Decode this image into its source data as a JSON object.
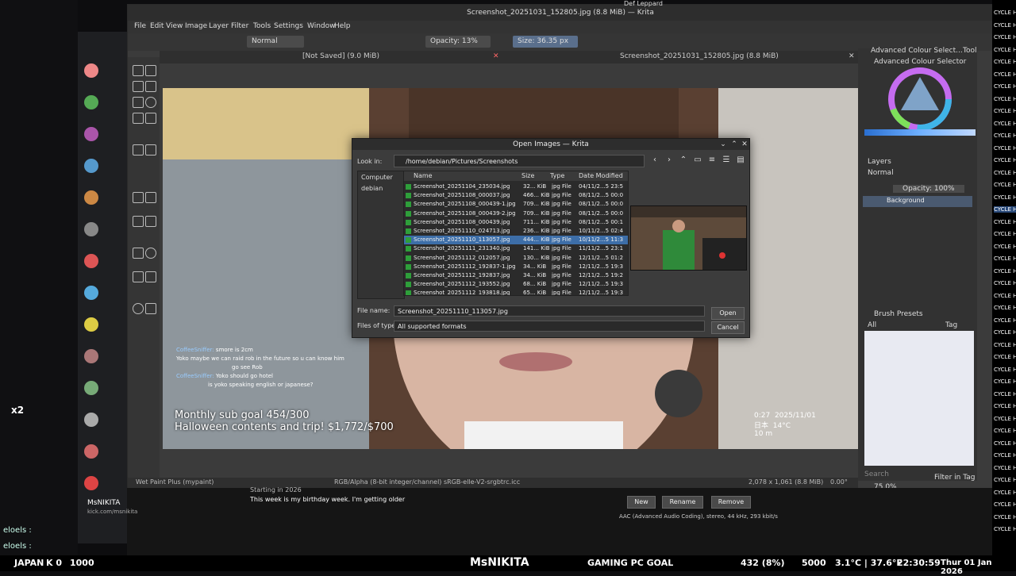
{
  "krita": {
    "title": "Screenshot_20251031_152805.jpg (8.8 MiB) — Krita",
    "menu": [
      "File",
      "Edit",
      "View",
      "Image",
      "Layer",
      "Filter",
      "Tools",
      "Settings",
      "Window",
      "Help"
    ],
    "blend_mode": "Normal",
    "opacity": "Opacity: 13%",
    "size": "Size: 36.35 px",
    "tab_unsaved": "[Not Saved]  (9.0 MiB)",
    "tab_doc": "Screenshot_20251031_152805.jpg (8.8 MiB)",
    "status_left": "Wet Paint Plus (mypaint)",
    "status_mid": "RGB/Alpha (8-bit integer/channel)  sRGB-elle-V2-srgbtrc.icc",
    "status_right": "2,078 x 1,061 (8.8 MiB)",
    "zoom": "75.0%",
    "rotation": "0.00°"
  },
  "dock": {
    "color_selector_tab": "Advanced Colour Select...",
    "tool_options_tab": "Tool Optio...",
    "color_selector_title": "Advanced Colour Selector",
    "layers_title": "Layers",
    "layers_mode": "Normal",
    "layers_opacity": "Opacity:  100%",
    "layer_name": "Background",
    "brush_title": "Brush Presets",
    "brush_filter": "All",
    "brush_tag": "Tag",
    "search": "Search",
    "filter_tag": "Filter in Tag"
  },
  "dialog": {
    "title": "Open Images — Krita",
    "look_in_label": "Look in:",
    "look_in_value": "/home/debian/Pictures/Screenshots",
    "places": [
      "Computer",
      "debian"
    ],
    "columns": [
      "Name",
      "Size",
      "Type",
      "Date Modified"
    ],
    "files": [
      {
        "name": "Screenshot_20251104_235034.jpg",
        "size": "32... KiB",
        "type": "jpg File",
        "date": "04/11/2...5 23:5"
      },
      {
        "name": "Screenshot_20251108_000037.jpg",
        "size": "466... KiB",
        "type": "jpg File",
        "date": "08/11/2...5 00:0"
      },
      {
        "name": "Screenshot_20251108_000439-1.jpg",
        "size": "709... KiB",
        "type": "jpg File",
        "date": "08/11/2...5 00:0"
      },
      {
        "name": "Screenshot_20251108_000439-2.jpg",
        "size": "709... KiB",
        "type": "jpg File",
        "date": "08/11/2...5 00:0"
      },
      {
        "name": "Screenshot_20251108_000439.jpg",
        "size": "711... KiB",
        "type": "jpg File",
        "date": "08/11/2...5 00:1"
      },
      {
        "name": "Screenshot_20251110_024713.jpg",
        "size": "236... KiB",
        "type": "jpg File",
        "date": "10/11/2...5 02:4"
      },
      {
        "name": "Screenshot_20251110_113057.jpg",
        "size": "444... KiB",
        "type": "jpg File",
        "date": "10/11/2...5 11:3"
      },
      {
        "name": "Screenshot_20251111_231340.jpg",
        "size": "141... KiB",
        "type": "jpg File",
        "date": "11/11/2...5 23:1"
      },
      {
        "name": "Screenshot_20251112_012057.jpg",
        "size": "130... KiB",
        "type": "jpg File",
        "date": "12/11/2...5 01:2"
      },
      {
        "name": "Screenshot_20251112_192837-1.jpg",
        "size": "34... KiB",
        "type": "jpg File",
        "date": "12/11/2...5 19:3"
      },
      {
        "name": "Screenshot_20251112_192837.jpg",
        "size": "34... KiB",
        "type": "jpg File",
        "date": "12/11/2...5 19:2"
      },
      {
        "name": "Screenshot_20251112_193552.jpg",
        "size": "68... KiB",
        "type": "jpg File",
        "date": "12/11/2...5 19:3"
      },
      {
        "name": "Screenshot_20251112_193818.jpg",
        "size": "65... KiB",
        "type": "jpg File",
        "date": "12/11/2...5 19:3"
      }
    ],
    "selected_index": 6,
    "file_name_label": "File name:",
    "file_name_value": "Screenshot_20251110_113057.jpg",
    "file_type_label": "Files of type:",
    "file_type_value": "All supported formats",
    "open_label": "Open",
    "cancel_label": "Cancel"
  },
  "stream": {
    "goal_line1": "Monthly sub goal 454/300",
    "goal_line2": "Halloween contents and trip! $1,772/$700",
    "chat": [
      {
        "user": "CoffeeSniffer:",
        "msg": "smore is 2cm"
      },
      {
        "user": "",
        "msg": "Yoko maybe we can raid rob in the future so u can know him"
      },
      {
        "user": "",
        "msg": "go see Rob"
      },
      {
        "user": "CoffeeSniffer:",
        "msg": "Yoko should go hotel"
      },
      {
        "user": "",
        "msg": "is yoko speaking english or japanese?"
      }
    ],
    "weather_time": "0:27",
    "weather_date": "2025/11/01",
    "weather_place": "日本",
    "weather_temp": "14°C",
    "weather_wind": "10 m",
    "multiplier": "x2",
    "chat_names": [
      "eloels :",
      "eloels :"
    ]
  },
  "obs": {
    "streamer": "MsNIKITA",
    "channel": "kick.com/msnikita",
    "msg1": "Starting in 2026",
    "msg2": "This week is my birthday week. I'm getting older",
    "btn_new": "New",
    "btn_rename": "Rename",
    "btn_remove": "Remove",
    "audio": "AAC (Advanced Audio Coding), stereo, 44 kHz, 293 kbit/s",
    "music_header": "Def Leppard"
  },
  "bottom": {
    "japan": "JAPAN",
    "k0": "K 0",
    "n1000": "1000",
    "brand": "MsNIKITA",
    "goal": "GAMING PC GOAL",
    "progress": "432 (8%)",
    "target": "5000",
    "weather": "3.1°C | 37.6°F",
    "clock": "22:30:59",
    "date": "Thur 01 Jan 2026"
  },
  "cycle_label": "CYCLE HI"
}
